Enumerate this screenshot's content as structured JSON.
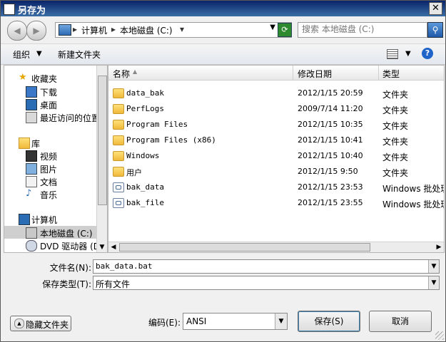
{
  "window": {
    "title": "另存为",
    "close_label": "✕"
  },
  "address": {
    "crumbs": [
      "计算机",
      "本地磁盘 (C:)"
    ],
    "search_placeholder": "搜索 本地磁盘 (C:)"
  },
  "toolbar": {
    "organize_label": "组织",
    "new_folder_label": "新建文件夹"
  },
  "nav": {
    "favorites_label": "收藏夹",
    "favorites": [
      "下载",
      "桌面",
      "最近访问的位置"
    ],
    "libraries_label": "库",
    "libraries": [
      "视频",
      "图片",
      "文档",
      "音乐"
    ],
    "computer_label": "计算机",
    "drives": [
      "本地磁盘 (C:)",
      "DVD 驱动器 (D"
    ]
  },
  "columns": {
    "name": "名称",
    "date": "修改日期",
    "type": "类型"
  },
  "files": [
    {
      "name": "data_bak",
      "date": "2012/1/15 20:59",
      "type": "文件夹",
      "icon": "folder-icon"
    },
    {
      "name": "PerfLogs",
      "date": "2009/7/14 11:20",
      "type": "文件夹",
      "icon": "folder-icon"
    },
    {
      "name": "Program Files",
      "date": "2012/1/15 10:35",
      "type": "文件夹",
      "icon": "folder-icon"
    },
    {
      "name": "Program Files (x86)",
      "date": "2012/1/15 10:41",
      "type": "文件夹",
      "icon": "folder-icon"
    },
    {
      "name": "Windows",
      "date": "2012/1/15 10:40",
      "type": "文件夹",
      "icon": "folder-icon"
    },
    {
      "name": "用户",
      "date": "2012/1/15 9:50",
      "type": "文件夹",
      "icon": "folder-icon"
    },
    {
      "name": "bak_data",
      "date": "2012/1/15 23:53",
      "type": "Windows 批处理",
      "icon": "batch-file-icon"
    },
    {
      "name": "bak_file",
      "date": "2012/1/15 23:55",
      "type": "Windows 批处理",
      "icon": "batch-file-icon"
    }
  ],
  "form": {
    "filename_label": "文件名(N):",
    "filename_value": "bak_data.bat",
    "filetype_label": "保存类型(T):",
    "filetype_value": "所有文件"
  },
  "bottom": {
    "hide_folders_label": "隐藏文件夹",
    "encoding_label": "编码(E):",
    "encoding_value": "ANSI",
    "save_label": "保存(S)",
    "cancel_label": "取消"
  }
}
